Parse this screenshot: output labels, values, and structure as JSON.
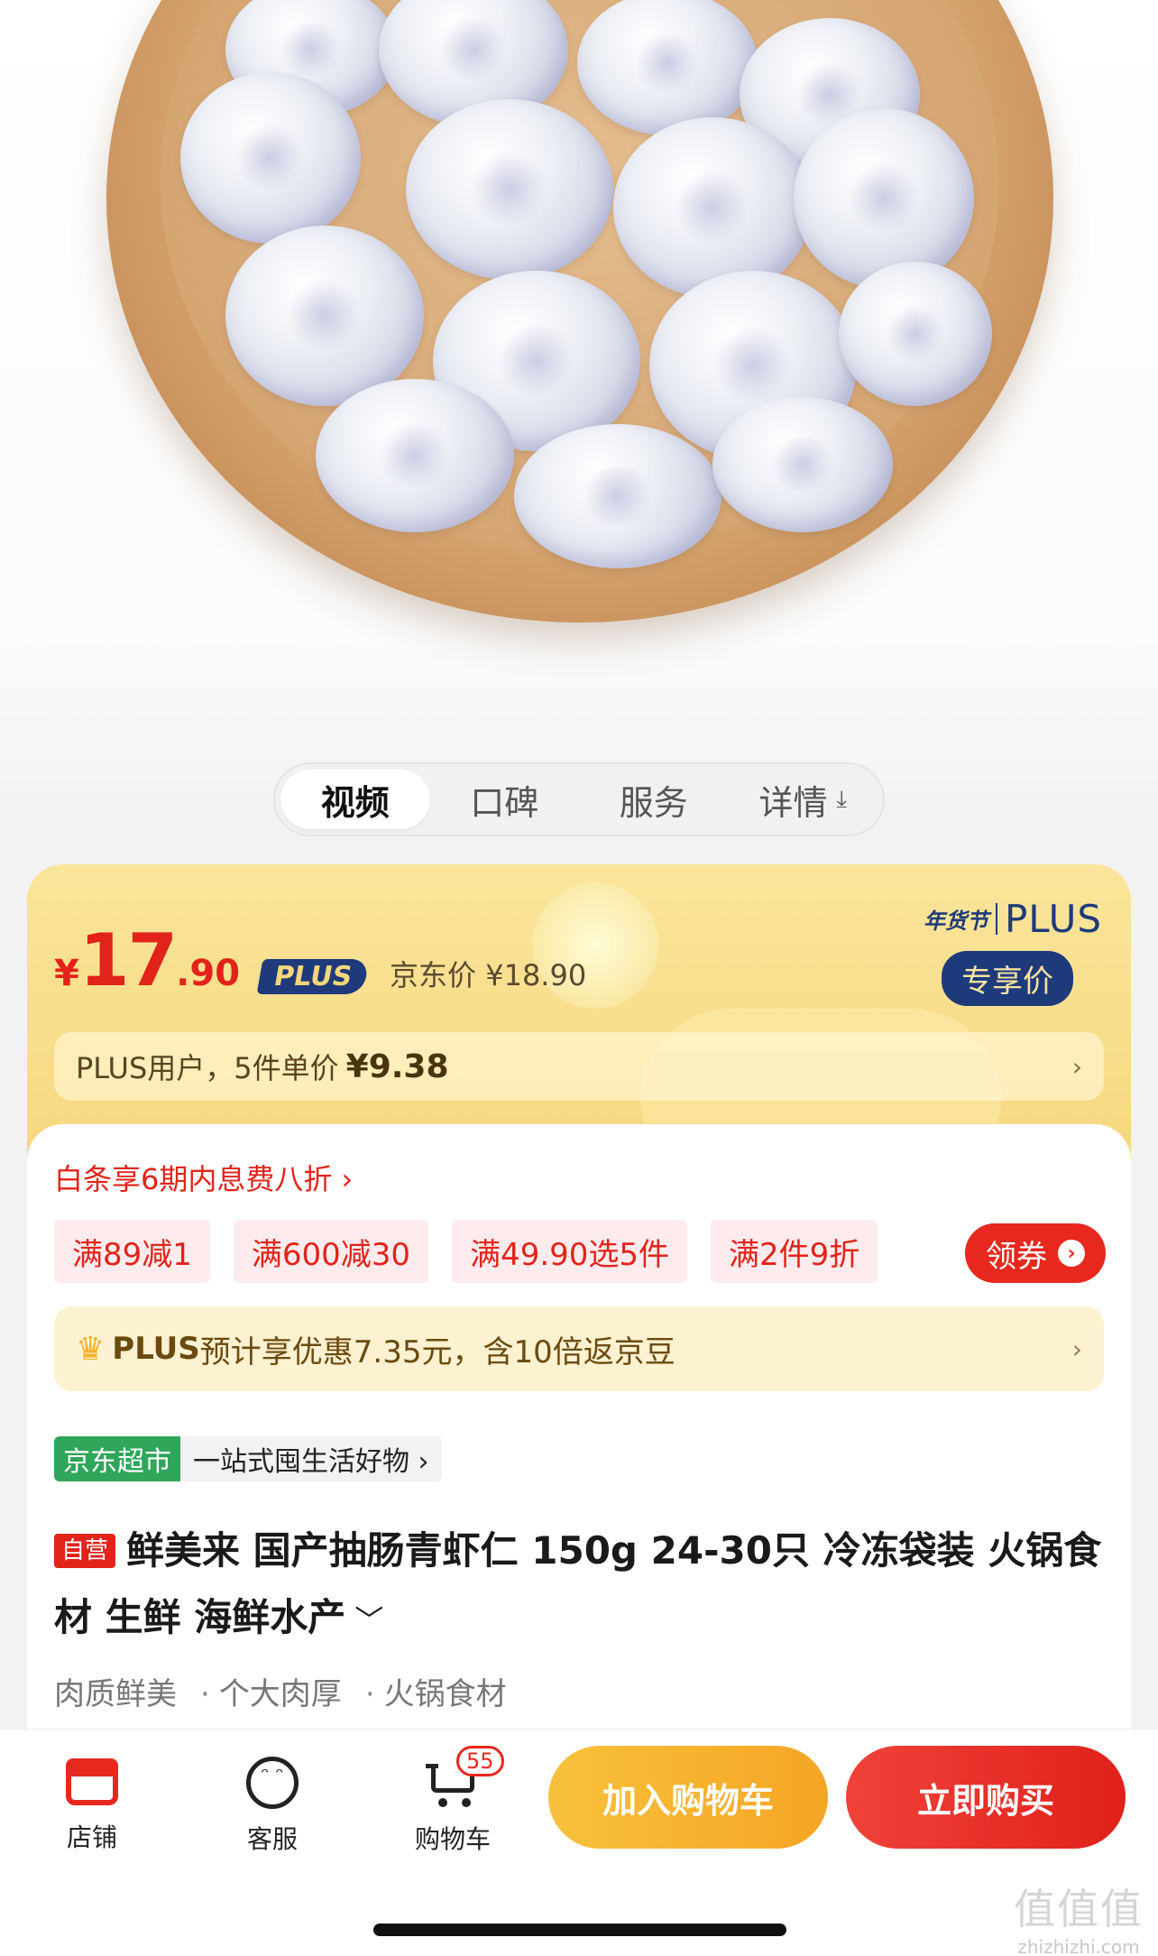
{
  "tabs": [
    {
      "label": "视频",
      "active": true
    },
    {
      "label": "口碑",
      "active": false
    },
    {
      "label": "服务",
      "active": false
    },
    {
      "label": "详情",
      "active": false
    }
  ],
  "tab_download_icon": "⤓",
  "price": {
    "currency": "¥",
    "integer": "17",
    "decimal": ".90",
    "plus_badge": "PLUS",
    "jd_price_label": "京东价 ¥18.90"
  },
  "festival": {
    "badge_text": "年货节",
    "plus_word": "PLUS",
    "exclusive_label": "专享价"
  },
  "plus_user": {
    "text": "PLUS用户，5件单价",
    "unit_price": "¥9.38",
    "chevron": "›"
  },
  "baitiao": "白条享6期内息费八折 ›",
  "coupons": [
    "满89减1",
    "满600减30",
    "满49.90选5件",
    "满2件9折"
  ],
  "get_coupon": {
    "label": "领券",
    "icon": "›"
  },
  "plus_expect": {
    "crown_icon": "♛",
    "plus_word": "PLUS",
    "text": "预计享优惠7.35元，含10倍返京豆",
    "chevron": "›"
  },
  "store": {
    "tag": "京东超市",
    "slogan": "一站式囤生活好物 ›"
  },
  "product": {
    "self_operated": "自营",
    "title": "鲜美来 国产抽肠青虾仁 150g 24-30只 冷冻袋装 火锅食材 生鲜 海鲜水产",
    "expand_icon": "﹀"
  },
  "features": [
    "肉质鲜美",
    "个大肉厚",
    "火锅食材"
  ],
  "bottom_bar": {
    "store_label": "店铺",
    "service_label": "客服",
    "cart_label": "购物车",
    "cart_count": "55",
    "add_to_cart": "加入购物车",
    "buy_now": "立即购买"
  },
  "watermark": {
    "big": "值值值",
    "small": "zhizhizhi.com"
  },
  "colors": {
    "accent": "#e2231a",
    "plus_navy": "#1e3a7b",
    "gold": "#f8dd8a"
  }
}
